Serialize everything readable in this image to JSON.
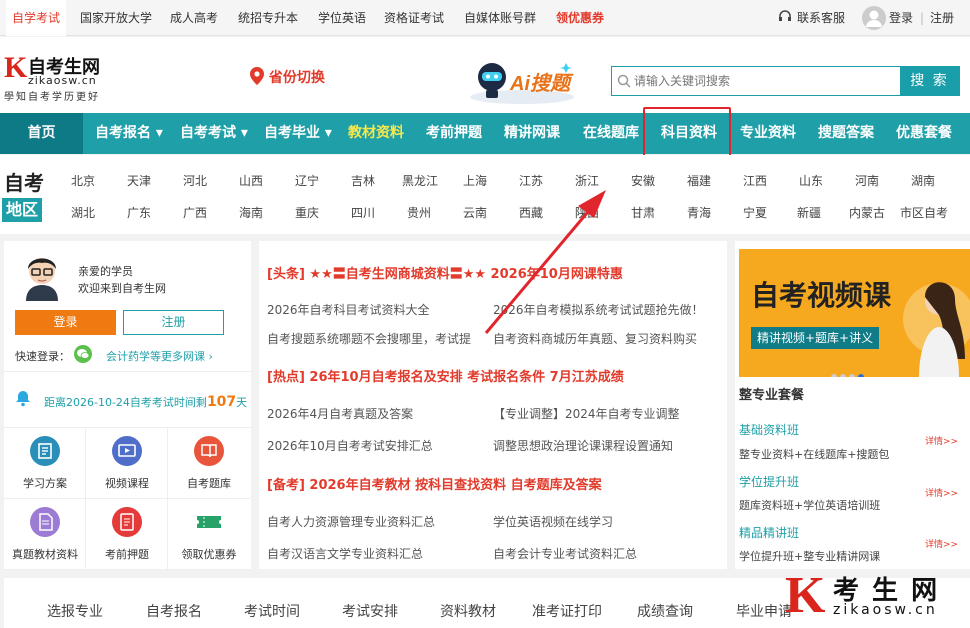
{
  "topbar": {
    "items": [
      "自学考试",
      "国家开放大学",
      "成人高考",
      "统招专升本",
      "学位英语",
      "资格证考试",
      "自媒体账号群",
      "领优惠券"
    ],
    "service": "联系客服",
    "login": "登录",
    "register": "注册"
  },
  "header": {
    "logo_title": "自考生网",
    "logo_domain": "zikaosw.cn",
    "logo_slogan": "學知自考学历更好",
    "province_switch": "省份切换",
    "ai_label": "Ai搜题",
    "search_placeholder": "请输入关键词搜索",
    "search_button": "搜 索"
  },
  "nav": {
    "items": [
      "首页",
      "自考报名",
      "自考考试",
      "自考毕业",
      "教材资料",
      "考前押题",
      "精讲网课",
      "在线题库",
      "科目资料",
      "专业资料",
      "搜题答案",
      "优惠套餐"
    ],
    "dropdown_marker": "▾"
  },
  "region": {
    "title": "自考",
    "badge": "地区",
    "row1": [
      "北京",
      "天津",
      "河北",
      "山西",
      "辽宁",
      "吉林",
      "黑龙江",
      "上海",
      "江苏",
      "浙江",
      "安徽",
      "福建",
      "江西",
      "山东",
      "河南",
      "湖南"
    ],
    "row2": [
      "湖北",
      "广东",
      "广西",
      "海南",
      "重庆",
      "四川",
      "贵州",
      "云南",
      "西藏",
      "陕西",
      "甘肃",
      "青海",
      "宁夏",
      "新疆",
      "内蒙古",
      "市区自考"
    ]
  },
  "user": {
    "greet1": "亲爱的学员",
    "greet2": "欢迎来到自考生网",
    "login_btn": "登录",
    "register_btn": "注册",
    "quick_login": "快速登录：",
    "quick_link": "会计药学等更多网课 ›",
    "countdown_prefix": "距离2026-10-24自考考试时间剩",
    "countdown_days": "107",
    "countdown_unit": "天"
  },
  "grid": [
    "学习方案",
    "视频课程",
    "自考题库",
    "真题教材资料",
    "考前押题",
    "领取优惠券"
  ],
  "news": {
    "head1": "[头条]  ★★〓自考生网商城资料〓★★   2026年10月网课特惠",
    "items1": [
      "2026年自考科目考试资料大全",
      "2026年自考模拟系统考试试题抢先做！",
      "自考搜题系统哪题不会搜哪里，考试提",
      "自考资料商城历年真题、复习资料购买"
    ],
    "head2": "[热点]  26年10月自考报名及安排   考试报名条件   7月江苏成绩",
    "items2": [
      "2026年4月自考真题及答案",
      "【专业调整】2024年自考专业调整",
      "2026年10月自考考试安排汇总",
      "调整思想政治理论课课程设置通知"
    ],
    "head3": "[备考]  2026年自考教材   按科目查找资料   自考题库及答案",
    "items3": [
      "自考人力资源管理专业资料汇总",
      "学位英语视频在线学习",
      "自考汉语言文学专业资料汇总",
      "自考会计专业考试资料汇总"
    ]
  },
  "promo": {
    "banner_title": "自考视频课",
    "banner_sub": "精讲视频+题库+讲义",
    "section_title": "整专业套餐",
    "more": "详情>>",
    "packages": [
      {
        "name": "基础资料班",
        "desc": "整专业资料+在线题库+搜题包"
      },
      {
        "name": "学位提升班",
        "desc": "题库资料班+学位英语培训班"
      },
      {
        "name": "精品精讲班",
        "desc": "学位提升班+整专业精讲网课"
      }
    ]
  },
  "footer": {
    "items": [
      "选报专业",
      "自考报名",
      "考试时间",
      "考试安排",
      "资料教材",
      "准考证打印",
      "成绩查询",
      "毕业申请"
    ]
  },
  "watermark": {
    "k": "K",
    "text": "考 生 网",
    "domain": "zikaosw.cn"
  },
  "colors": {
    "accent": "#1fa0a8",
    "nav_active": "#0d7a85",
    "red": "#e23b2c",
    "orange": "#f07a12",
    "highlight_yellow": "#f8e84a"
  }
}
